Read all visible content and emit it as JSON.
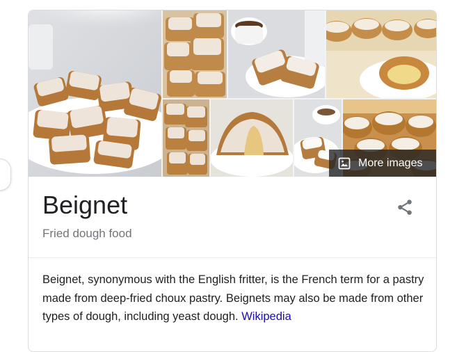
{
  "knowledge_panel": {
    "title": "Beignet",
    "subtitle": "Fried dough food",
    "description": "Beignet, synonymous with the English fritter, is the French term for a pastry made from deep-fried choux pastry. Beignets may also be made from other types of dough, including yeast dough.",
    "source_link": "Wikipedia",
    "more_images_label": "More images"
  },
  "gallery": {
    "images": [
      {
        "alt": "plate of powdered beignets with sugar sifter"
      },
      {
        "alt": "stacked beignets close-up"
      },
      {
        "alt": "beignets with coffee cup"
      },
      {
        "alt": "filled beignet on plate"
      },
      {
        "alt": "beignets pile"
      },
      {
        "alt": "beignet cut open"
      },
      {
        "alt": "beignets with coffee"
      },
      {
        "alt": "round beignets on platter"
      }
    ]
  },
  "icons": {
    "image_icon": "image-icon",
    "share_icon": "share-icon"
  },
  "colors": {
    "link": "#1a0dab",
    "subtitle": "#70757a",
    "text": "#202124",
    "overlay": "#202124"
  }
}
